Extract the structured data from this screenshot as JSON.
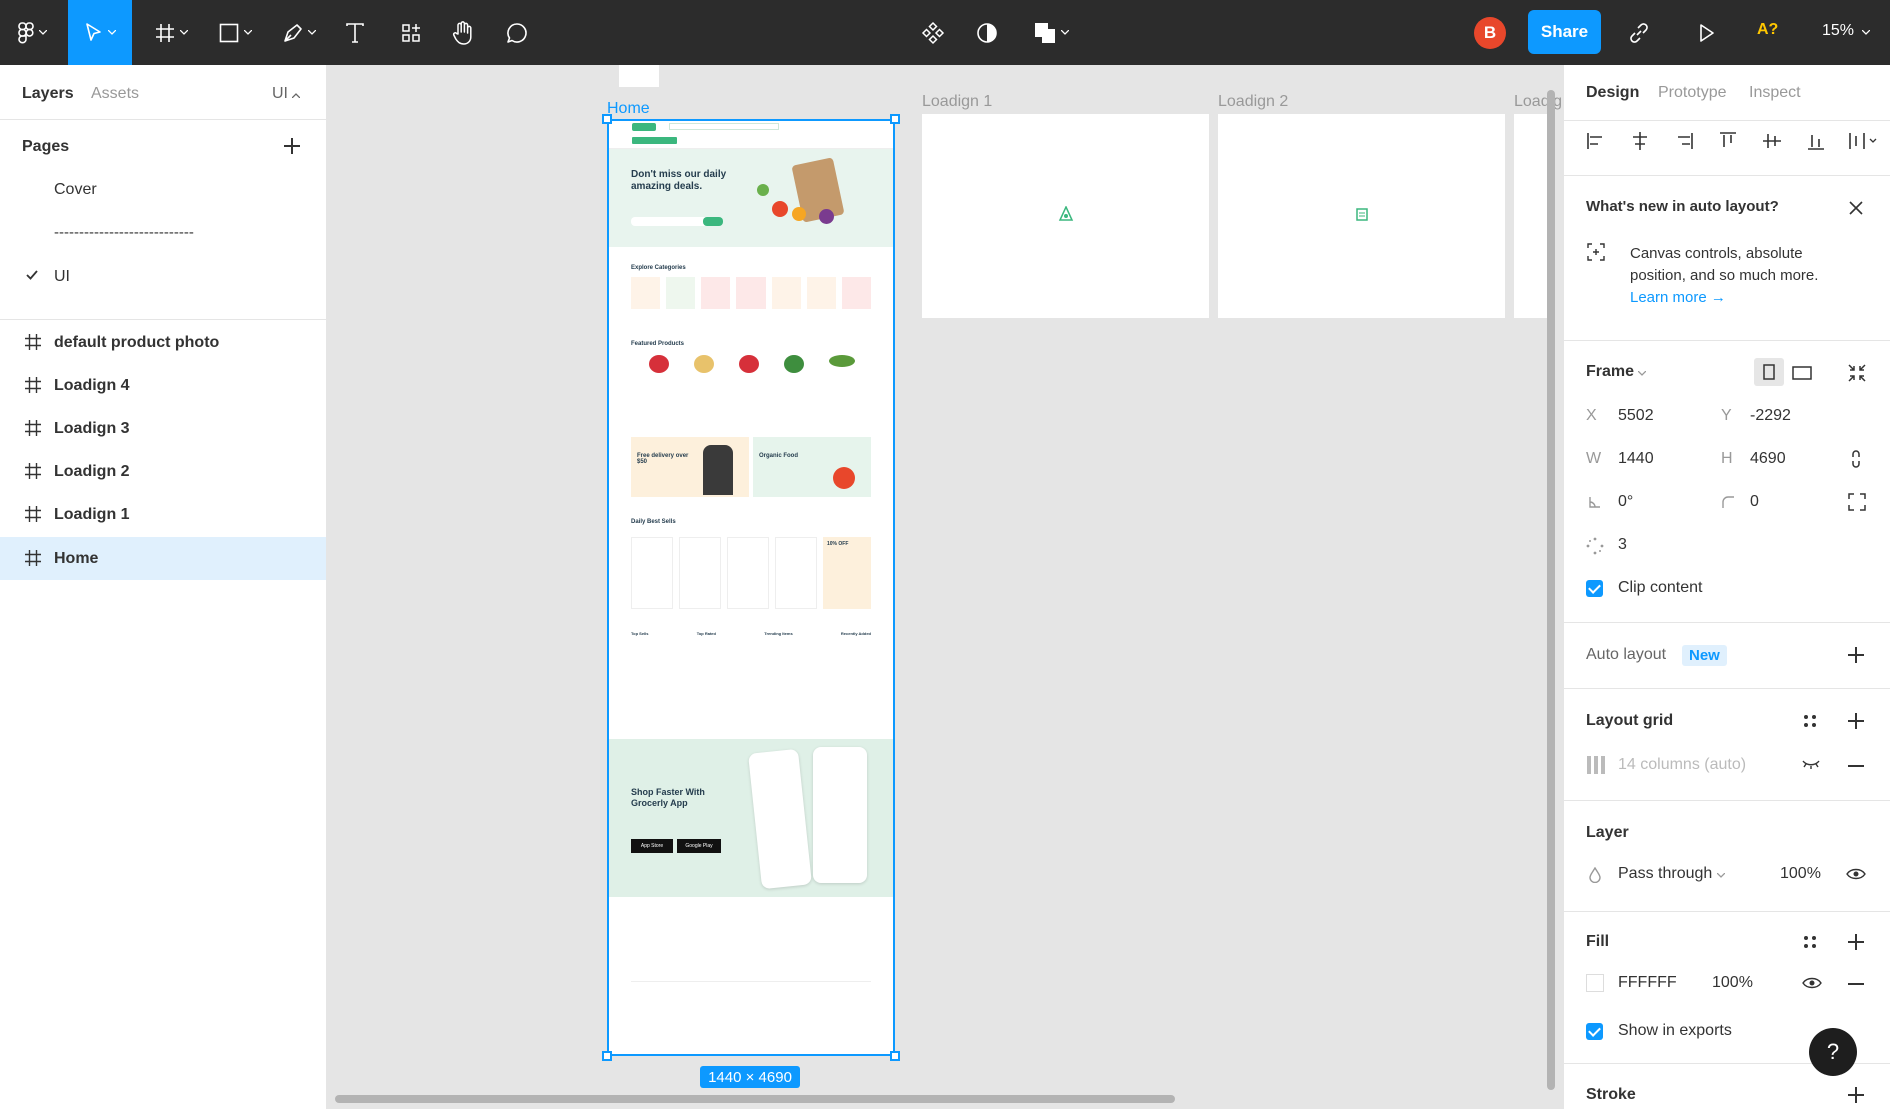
{
  "toolbar": {
    "avatar_letter": "B",
    "share_label": "Share",
    "a11y_label": "A?",
    "zoom": "15%"
  },
  "left_panel": {
    "tabs": [
      "Layers",
      "Assets"
    ],
    "ui_selector": "UI",
    "pages_header": "Pages",
    "pages": [
      "Cover",
      "----------------------------",
      "UI"
    ],
    "current_page": "UI",
    "layers": [
      "default product photo",
      "Loadign 4",
      "Loadign 3",
      "Loadign 2",
      "Loadign 1",
      "Home"
    ],
    "selected_layer": "Home"
  },
  "canvas": {
    "frame_labels": [
      "Home",
      "Loadign 1",
      "Loadign 2",
      "Loadig"
    ],
    "size_badge": "1440 × 4690",
    "home_mock": {
      "hero_title": "Don't miss our daily amazing deals.",
      "categories_title": "Explore Categories",
      "featured_title": "Featured Products",
      "promo1": "Free delivery over $50",
      "promo2": "Organic Food",
      "daily_title": "Daily Best Sells",
      "discount": "10% OFF",
      "lists": [
        "Top Sells",
        "Top Rated",
        "Trending Items",
        "Recently Added"
      ],
      "app_title": "Shop Faster With Grocerly App",
      "store1": "App Store",
      "store2": "Google Play"
    }
  },
  "right_panel": {
    "tabs": [
      "Design",
      "Prototype",
      "Inspect"
    ],
    "active_tab": "Design",
    "whatsnew_title": "What's new in auto layout?",
    "whatsnew_body_1": "Canvas controls, absolute",
    "whatsnew_body_2": "position, and so much more.",
    "whatsnew_link": "Learn more →",
    "frame_label": "Frame",
    "x_label": "X",
    "x_value": "5502",
    "y_label": "Y",
    "y_value": "-2292",
    "w_label": "W",
    "w_value": "1440",
    "h_label": "H",
    "h_value": "4690",
    "rotation": "0°",
    "radius": "0",
    "count": "3",
    "clip_content": "Clip content",
    "auto_layout": "Auto layout",
    "new_badge": "New",
    "layout_grid": "Layout grid",
    "grid_value": "14 columns (auto)",
    "layer_header": "Layer",
    "blend_mode": "Pass through",
    "layer_opacity": "100%",
    "fill_header": "Fill",
    "fill_hex": "FFFFFF",
    "fill_opacity": "100%",
    "show_exports": "Show in exports",
    "stroke_header": "Stroke",
    "help": "?"
  },
  "colors": {
    "accent": "#0d99ff",
    "toolbar": "#2c2c2c",
    "avatar": "#e8472b",
    "brand_green": "#3bb77e"
  }
}
